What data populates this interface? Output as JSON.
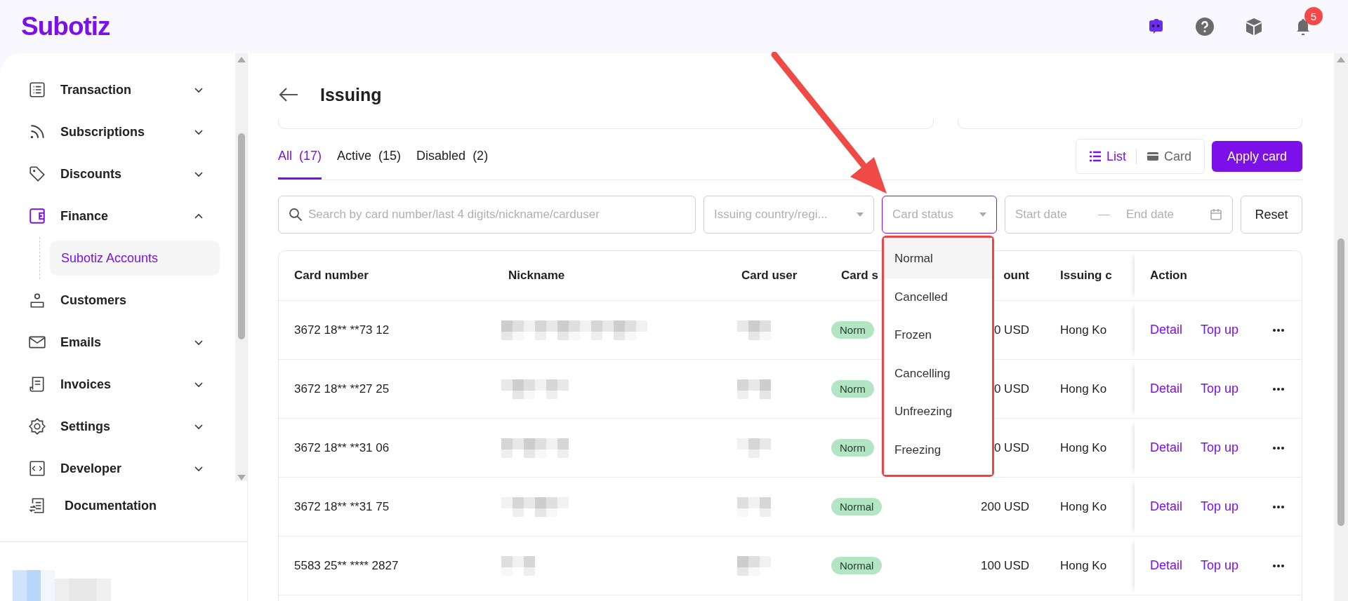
{
  "brand": "Subotiz",
  "header": {
    "notifications": "5"
  },
  "sidebar": {
    "items": [
      {
        "label": "Transaction",
        "kind": "group",
        "expanded": false
      },
      {
        "label": "Subscriptions",
        "kind": "group",
        "expanded": false
      },
      {
        "label": "Discounts",
        "kind": "group",
        "expanded": false
      },
      {
        "label": "Finance",
        "kind": "group",
        "expanded": true,
        "children": [
          {
            "label": "Subotiz Accounts",
            "selected": true
          }
        ]
      },
      {
        "label": "Customers",
        "kind": "link"
      },
      {
        "label": "Emails",
        "kind": "group",
        "expanded": false
      },
      {
        "label": "Invoices",
        "kind": "group",
        "expanded": false
      },
      {
        "label": "Settings",
        "kind": "group",
        "expanded": false
      },
      {
        "label": "Developer",
        "kind": "group",
        "expanded": false
      }
    ],
    "footer_item": "Documentation"
  },
  "page": {
    "title": "Issuing",
    "tabs": [
      {
        "label": "All",
        "count": "(17)",
        "selected": true
      },
      {
        "label": "Active",
        "count": "(15)",
        "selected": false
      },
      {
        "label": "Disabled",
        "count": "(2)",
        "selected": false
      }
    ],
    "views": [
      {
        "label": "List",
        "selected": true
      },
      {
        "label": "Card",
        "selected": false
      }
    ],
    "apply_button": "Apply card",
    "filters": {
      "search": {
        "placeholder": "Search by card number/last 4 digits/nickname/carduser"
      },
      "country": {
        "placeholder": "Issuing country/regi..."
      },
      "status": {
        "placeholder": "Card status",
        "open": true,
        "options": [
          {
            "label": "Normal",
            "selected": true
          },
          {
            "label": "Cancelled",
            "selected": false
          },
          {
            "label": "Frozen",
            "selected": false
          },
          {
            "label": "Cancelling",
            "selected": false
          },
          {
            "label": "Unfreezing",
            "selected": false
          },
          {
            "label": "Freezing",
            "selected": false
          }
        ]
      },
      "date": {
        "start_placeholder": "Start date",
        "separator": "—",
        "end_placeholder": "End date"
      },
      "reset": "Reset"
    },
    "table": {
      "columns": [
        "Card number",
        "Nickname",
        "Card user",
        "Card s",
        "ount",
        "Issuing c",
        "Action"
      ],
      "rows": [
        {
          "card_number": "3672 18** **73 12",
          "status": "Norm",
          "amount": "0 USD",
          "issuing": "Hong Ko",
          "actions": [
            "Detail",
            "Top up"
          ]
        },
        {
          "card_number": "3672 18** **27 25",
          "status": "Norm",
          "amount": "0 USD",
          "issuing": "Hong Ko",
          "actions": [
            "Detail",
            "Top up"
          ]
        },
        {
          "card_number": "3672 18** **31 06",
          "status": "Norm",
          "amount": "0 USD",
          "issuing": "Hong Ko",
          "actions": [
            "Detail",
            "Top up"
          ]
        },
        {
          "card_number": "3672 18** **31 75",
          "status": "Normal",
          "amount": "200 USD",
          "issuing": "Hong Ko",
          "actions": [
            "Detail",
            "Top up"
          ]
        },
        {
          "card_number": "5583 25** **** 2827",
          "status": "Normal",
          "amount": "100 USD",
          "issuing": "Hong Ko",
          "actions": [
            "Detail",
            "Top up"
          ]
        }
      ]
    }
  }
}
